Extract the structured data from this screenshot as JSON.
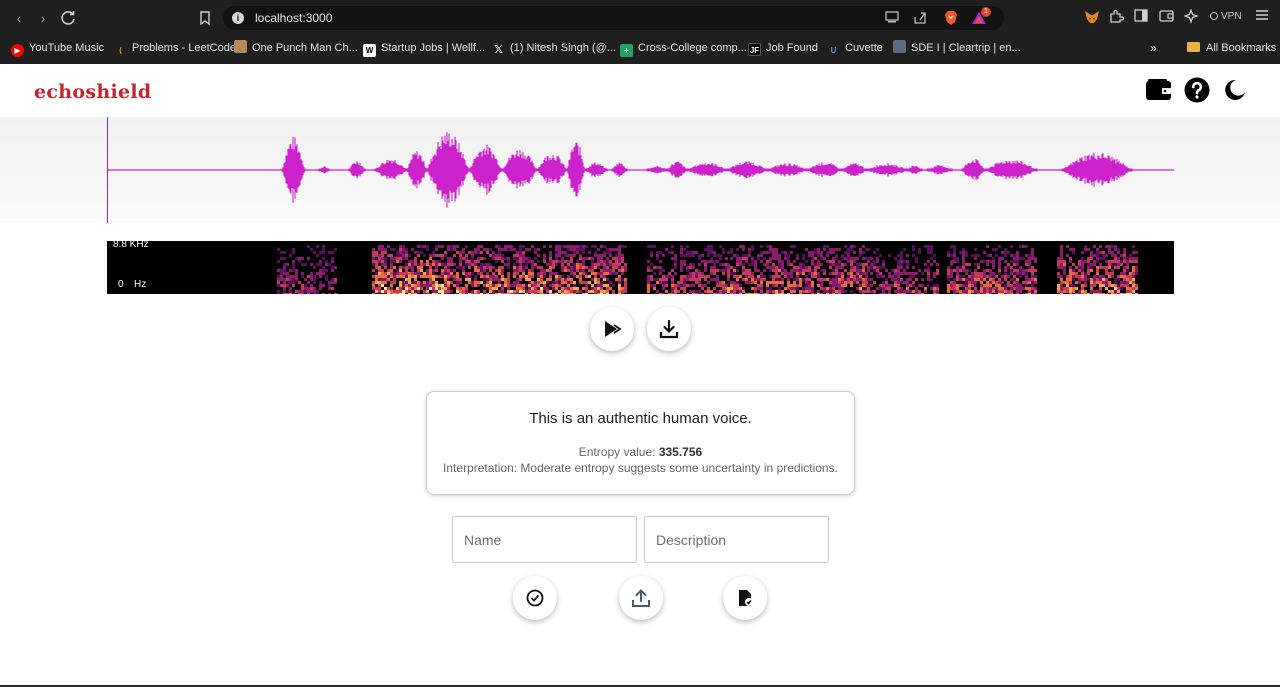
{
  "browser": {
    "url": "localhost:3000",
    "rewards_count": "1",
    "vpn_label": "VPN",
    "colors": {
      "chrome_bg": "#1f1f1f",
      "urlbar_bg": "#121212"
    },
    "icons": [
      "back-icon",
      "forward-icon",
      "reload-icon",
      "bookmark-icon",
      "site-info-icon",
      "cast-icon",
      "share-icon",
      "brave-shields-icon",
      "brave-rewards-icon",
      "metamask-icon",
      "extensions-icon",
      "sidebar-icon",
      "wallet-icon",
      "leo-ai-icon",
      "menu-icon"
    ]
  },
  "bookmarks": {
    "items": [
      {
        "label": "YouTube Music",
        "icon": "youtube-music-icon"
      },
      {
        "label": "Problems - LeetCode",
        "icon": "leetcode-icon"
      },
      {
        "label": "One Punch Man Ch...",
        "icon": "manga-icon"
      },
      {
        "label": "Startup Jobs | Wellf...",
        "icon": "wellfound-icon"
      },
      {
        "label": "(1) Nitesh Singh (@...",
        "icon": "x-icon"
      },
      {
        "label": "Cross-College comp...",
        "icon": "sheets-icon"
      },
      {
        "label": "Job Found",
        "icon": "jobfound-icon"
      },
      {
        "label": "Cuvette",
        "icon": "cuvette-icon"
      },
      {
        "label": "SDE I | Cleartrip | en...",
        "icon": "cleartrip-icon"
      }
    ],
    "all_label": "All Bookmarks"
  },
  "app": {
    "logo": "echoshield",
    "header_icons": [
      "wallet-icon",
      "help-icon",
      "dark-mode-icon"
    ],
    "colors": {
      "brand": "#c4262f",
      "waveform": "#cc22cc",
      "cursor": "#b321b3"
    }
  },
  "spectrogram": {
    "top_label": "8.8 KHz",
    "bottom_label": "0",
    "bottom_unit": "Hz"
  },
  "controls": {
    "icons": [
      "play-icon",
      "download-icon"
    ]
  },
  "result": {
    "title": "This is an authentic human voice.",
    "entropy_label": "Entropy value: ",
    "entropy_value": "335.756",
    "interpretation": "Interpretation: Moderate entropy suggests some uncertainty in predictions."
  },
  "form": {
    "name_placeholder": "Name",
    "description_placeholder": "Description",
    "icons": [
      "check-circle-icon",
      "upload-icon",
      "save-file-icon"
    ]
  }
}
